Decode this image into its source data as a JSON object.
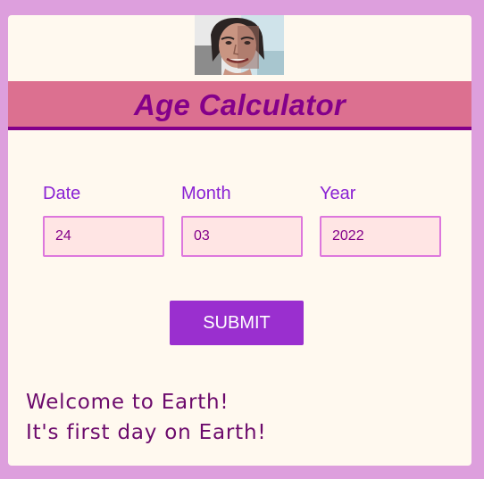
{
  "header": {
    "title": "Age Calculator",
    "image": "aging-face-photo"
  },
  "form": {
    "date": {
      "label": "Date",
      "value": "24"
    },
    "month": {
      "label": "Month",
      "value": "03"
    },
    "year": {
      "label": "Year",
      "value": "2022"
    },
    "submit_label": "SUBMIT"
  },
  "result": {
    "line1": "Welcome to Earth!",
    "line2": "It's first day on Earth!"
  },
  "colors": {
    "page_bg": "#dd9fdd",
    "card_bg": "#fff9ef",
    "header_bg": "#dc7090",
    "accent": "#84008a",
    "label": "#8a21d4",
    "input_bg": "#ffe5e4",
    "input_border": "#dd77dd",
    "button": "#9a2fcf",
    "result_text": "#6c0a6c"
  }
}
